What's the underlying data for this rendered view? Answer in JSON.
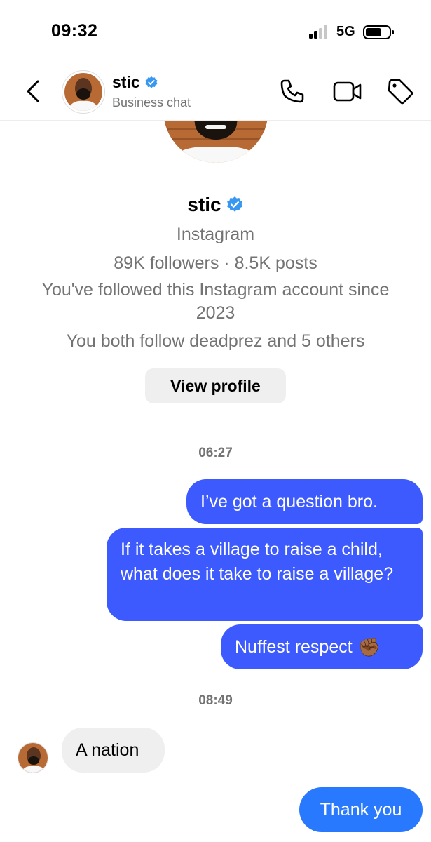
{
  "status_bar": {
    "time": "09:32",
    "network": "5G"
  },
  "header": {
    "name": "stic",
    "subtitle": "Business chat",
    "icons": [
      "chevron-left-icon",
      "phone-icon",
      "video-icon",
      "tag-icon"
    ]
  },
  "profile": {
    "name": "stic",
    "platform": "Instagram",
    "stats": "89K followers · 8.5K posts",
    "followed_line1": "You've followed this Instagram account since",
    "followed_line2": "2023",
    "mutual": "You both follow deadprez and 5 others",
    "view_profile_label": "View profile"
  },
  "chat": {
    "timestamp1": "06:27",
    "out_msg1": "I’ve got a question bro.",
    "out_msg2": "If it takes a village to raise a child, what does it take to raise a village?",
    "out_msg3": "Nuffest respect",
    "out_msg3_emoji": "✊🏾",
    "timestamp2": "08:49",
    "in_msg1": "A nation",
    "out_msg4": "Thank you"
  },
  "colors": {
    "bubble_blue": "#3d5afe",
    "bubble_light_blue": "#2979ff",
    "verified_blue": "#3897f0",
    "grey_text": "#737373",
    "grey_bg": "#efefef"
  }
}
